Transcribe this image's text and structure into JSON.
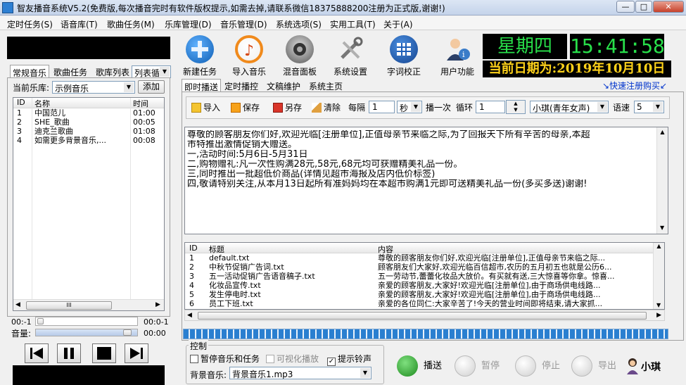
{
  "title": "智友播音系统V5.2(免费版,每次播音完时有软件版权提示,如需去掉,请联系微信18375888200注册为正式版,谢谢!)",
  "menu": [
    "定时任务(S)",
    "语音库(T)",
    "歌曲任务(M)",
    "乐库管理(D)",
    "音乐管理(D)",
    "系统选项(S)",
    "实用工具(T)",
    "关于(A)"
  ],
  "window_buttons": [
    "—",
    "□",
    "✕"
  ],
  "left": {
    "tabs": [
      "常规音乐",
      "歌曲任务",
      "歌库列表",
      "列表循"
    ],
    "library_label": "当前乐库:",
    "library_value": "示例音乐",
    "add_button": "添加",
    "columns": [
      "ID",
      "名称",
      "时间"
    ],
    "songs": [
      {
        "id": "1",
        "name": "中国范儿",
        "time": "01:00"
      },
      {
        "id": "2",
        "name": "SHE_歌曲",
        "time": "00:05"
      },
      {
        "id": "3",
        "name": "迪克兰歌曲",
        "time": "01:08"
      },
      {
        "id": "4",
        "name": "如需更多背景音乐,...",
        "time": "00:08"
      }
    ],
    "scroll_mark": "III",
    "position_left": "00:-1",
    "position_right": "00:0-1",
    "volume_label": "音量:",
    "volume_right": "00:00"
  },
  "toolbar": [
    {
      "label": "新建任务",
      "icon": "plus-icon",
      "color": "#1a73c9"
    },
    {
      "label": "导入音乐",
      "icon": "music-note-icon",
      "color": "#f08a1c"
    },
    {
      "label": "混音面板",
      "icon": "mixer-icon",
      "color": "#666666"
    },
    {
      "label": "系统设置",
      "icon": "tools-icon",
      "color": "#8a8a8a"
    },
    {
      "label": "字词校正",
      "icon": "table-icon",
      "color": "#1e5fb8"
    },
    {
      "label": "用户功能",
      "icon": "user-icon",
      "color": "#3a7cc8"
    }
  ],
  "clock": {
    "day": "星期四",
    "time": "15:41:58",
    "date": "当前日期为:2019年10月10日"
  },
  "right_tabs": [
    "即时播送",
    "定时播控",
    "文稿维护",
    "系统主页"
  ],
  "register_link": "↘快速注册购买↙",
  "options": {
    "import": "导入",
    "save": "保存",
    "save_as": "另存",
    "clear": "清除",
    "every_label": "每隔",
    "every_value": "1",
    "unit": "秒",
    "play_once": "播一次",
    "loop_label": "循环",
    "loop_value": "1",
    "voice": "小琪(青年女声)",
    "speed_label": "语速",
    "speed_value": "5"
  },
  "broadcast_text": [
    "尊敬的顾客朋友你们好,欢迎光临[注册单位],正值母亲节来临之际,为了回报天下所有辛苦的母亲,本超",
    "市特推出激情促销大赠送。",
    "一,活动时间:5月6日-5月31日",
    "二,购物赠礼:凡一次性购满28元,58元,68元均可获赠精美礼品一份。",
    "三,同时推出一批超低价商品(详情见超市海报及店内低价标签)",
    "四,敬请特别关注,从本月13日起所有准妈妈均在本超市购满1元即可送精美礼品一份(多买多送)谢谢!"
  ],
  "file_columns": [
    "ID",
    "标题",
    "内容"
  ],
  "files": [
    {
      "id": "1",
      "title": "default.txt",
      "content": "尊敬的顾客朋友你们好,欢迎光临[注册单位],正值母亲节来临之际..."
    },
    {
      "id": "2",
      "title": "中秋节促销广告词.txt",
      "content": "顾客朋友们大家好,欢迎光临百信超市,农历的五月初五也就是公历6..."
    },
    {
      "id": "3",
      "title": "五一活动促销广告语音稿子.txt",
      "content": "五一劳动节,蕾蕾化妆品大放价。有买就有送,三大惊喜等你拿。惊喜..."
    },
    {
      "id": "4",
      "title": "化妆品宣传.txt",
      "content": "亲爱的顾客朋友,大家好!欢迎光临[注册单位],由于商场供电线路..."
    },
    {
      "id": "5",
      "title": "发生停电时.txt",
      "content": "亲爱的顾客朋友,大家好!欢迎光临[注册单位],由于商场供电线路..."
    },
    {
      "id": "6",
      "title": "员工下班.txt",
      "content": "亲爱的各位同仁:大家辛苦了!今天的营业时间即将结束,请大家抓..."
    }
  ],
  "control": {
    "group_label": "控制",
    "pause_music": "暂停音乐和任务",
    "visual": "可视化播放",
    "ringtone": "提示铃声",
    "bg_label": "背景音乐:",
    "bg_value": "背景音乐1.mp3"
  },
  "playback": {
    "broadcast": "播送",
    "pause": "暂停",
    "stop": "停止",
    "export": "导出",
    "voice_name": "小琪"
  }
}
